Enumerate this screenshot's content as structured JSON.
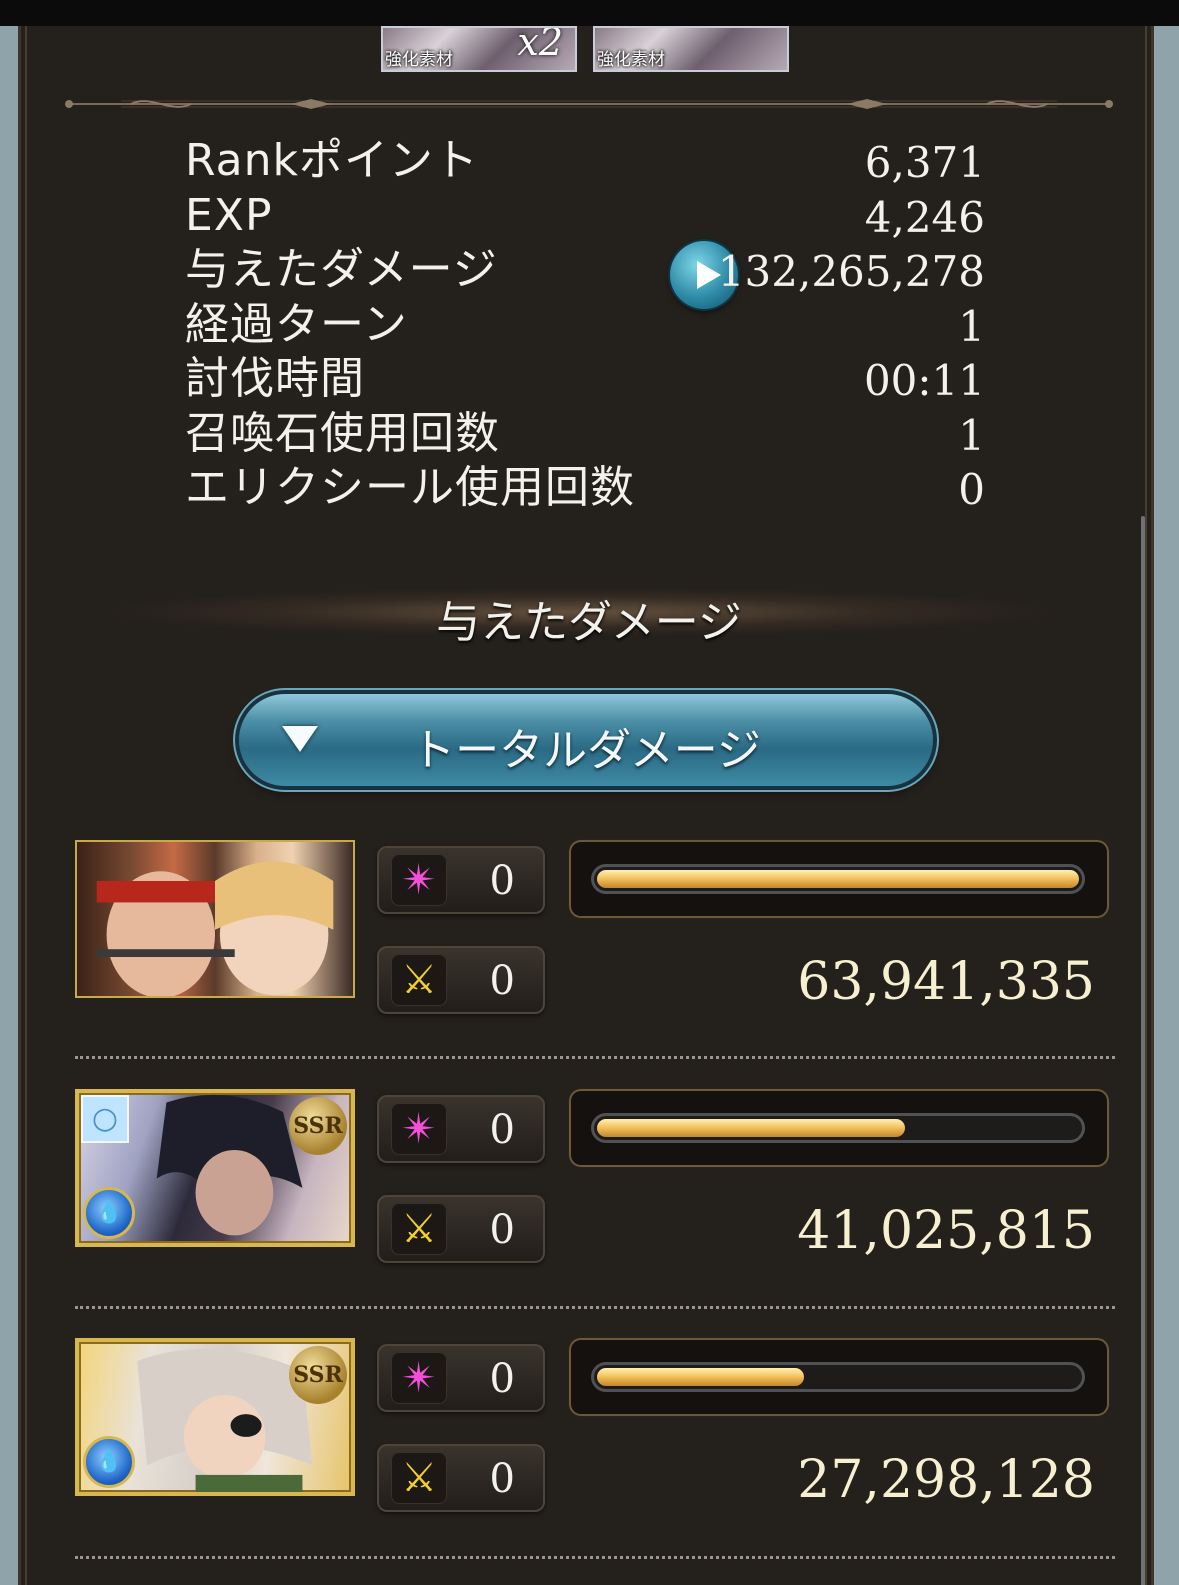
{
  "rewards": [
    {
      "tag": "強化素材",
      "count": "x2"
    },
    {
      "tag": "強化素材",
      "count": ""
    }
  ],
  "stats": [
    {
      "label": "Rankポイント",
      "value": "6,371"
    },
    {
      "label": "EXP",
      "value": "4,246"
    },
    {
      "label": "与えたダメージ",
      "value": "132,265,278"
    },
    {
      "label": "経過ターン",
      "value": "1"
    },
    {
      "label": "討伐時間",
      "value": "00:11"
    },
    {
      "label": "召喚石使用回数",
      "value": "1"
    },
    {
      "label": "エリクシール使用回数",
      "value": "0"
    }
  ],
  "damage_section": {
    "title": "与えたダメージ",
    "selector_label": "トータルダメージ"
  },
  "colors": {
    "accent_blue": "#2a6a84",
    "bar_gold": "#f4c460",
    "burst_pink": "#f44fd9",
    "chain_yellow": "#f2d02e"
  },
  "entries": [
    {
      "ssr": false,
      "badge": "",
      "special": "0",
      "chain": "0",
      "damage": "63,941,335",
      "bar_fraction": 1.0
    },
    {
      "ssr": true,
      "badge": "SSR",
      "special": "0",
      "chain": "0",
      "damage": "41,025,815",
      "bar_fraction": 0.64
    },
    {
      "ssr": true,
      "badge": "SSR",
      "special": "0",
      "chain": "0",
      "damage": "27,298,128",
      "bar_fraction": 0.43
    }
  ]
}
